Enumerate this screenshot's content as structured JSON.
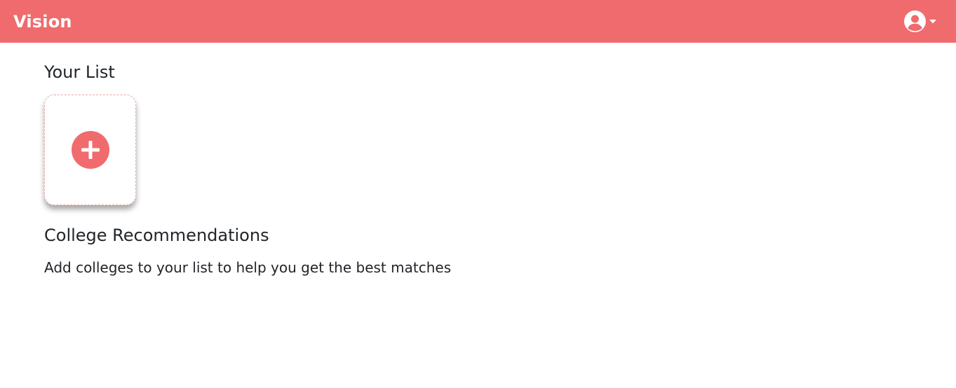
{
  "navbar": {
    "brand": "Vision",
    "background_color": "#f06b6d",
    "user_icon": "user-circle-icon",
    "dropdown_icon": "caret-down-icon"
  },
  "your_list": {
    "heading": "Your List",
    "add_card_icon": "plus-circle-icon",
    "accent_color": "#f06b6d"
  },
  "recommendations": {
    "heading": "College Recommendations",
    "message": "Add colleges to your list to help you get the best matches"
  }
}
